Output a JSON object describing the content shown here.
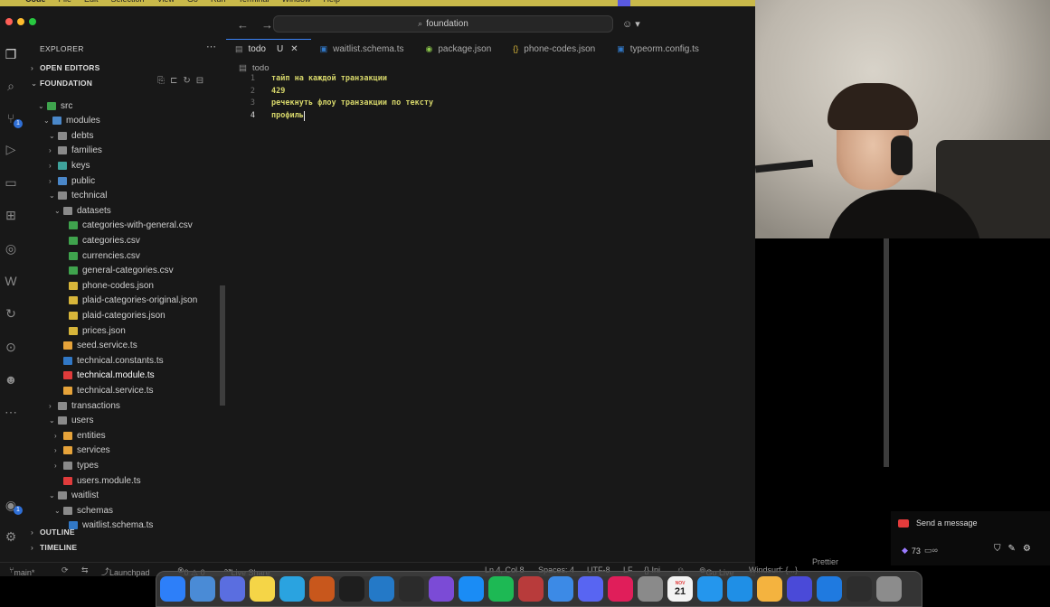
{
  "menubar": {
    "items": [
      "Code",
      "File",
      "Edit",
      "Selection",
      "View",
      "Go",
      "Run",
      "Terminal",
      "Window",
      "Help"
    ]
  },
  "titlebar": {
    "search_text": "foundation"
  },
  "sidebar": {
    "title": "EXPLORER",
    "sections": {
      "open_editors": "OPEN EDITORS",
      "foundation": "FOUNDATION",
      "outline": "OUTLINE",
      "timeline": "TIMELINE"
    },
    "tree": [
      {
        "label": "src",
        "kind": "folder-open",
        "color": "#3fa34d"
      },
      {
        "label": "modules",
        "kind": "folder-open",
        "color": "#4a87c9"
      },
      {
        "label": "debts",
        "kind": "folder-open",
        "color": "#8a8a8a"
      },
      {
        "label": "families",
        "kind": "folder",
        "color": "#8a8a8a"
      },
      {
        "label": "keys",
        "kind": "folder",
        "color": "#3fa39c"
      },
      {
        "label": "public",
        "kind": "folder",
        "color": "#4a87c9"
      },
      {
        "label": "technical",
        "kind": "folder-open",
        "color": "#8a8a8a"
      },
      {
        "label": "datasets",
        "kind": "folder-open",
        "color": "#8a8a8a"
      },
      {
        "label": "categories-with-general.csv",
        "kind": "csv",
        "color": "#3fa34d"
      },
      {
        "label": "categories.csv",
        "kind": "csv",
        "color": "#3fa34d"
      },
      {
        "label": "currencies.csv",
        "kind": "csv",
        "color": "#3fa34d"
      },
      {
        "label": "general-categories.csv",
        "kind": "csv",
        "color": "#3fa34d"
      },
      {
        "label": "phone-codes.json",
        "kind": "json",
        "color": "#d7b53a"
      },
      {
        "label": "plaid-categories-original.json",
        "kind": "json",
        "color": "#d7b53a"
      },
      {
        "label": "plaid-categories.json",
        "kind": "json",
        "color": "#d7b53a"
      },
      {
        "label": "prices.json",
        "kind": "json",
        "color": "#d7b53a"
      },
      {
        "label": "seed.service.ts",
        "kind": "ts-service",
        "color": "#e6a33a"
      },
      {
        "label": "technical.constants.ts",
        "kind": "ts",
        "color": "#3178c6"
      },
      {
        "label": "technical.module.ts",
        "kind": "ts-module",
        "color": "#e03b3b"
      },
      {
        "label": "technical.service.ts",
        "kind": "ts-service",
        "color": "#e6a33a"
      },
      {
        "label": "transactions",
        "kind": "folder",
        "color": "#8a8a8a"
      },
      {
        "label": "users",
        "kind": "folder-open",
        "color": "#8a8a8a"
      },
      {
        "label": "entities",
        "kind": "folder",
        "color": "#e6a33a"
      },
      {
        "label": "services",
        "kind": "folder",
        "color": "#e6a33a"
      },
      {
        "label": "types",
        "kind": "folder",
        "color": "#8a8a8a"
      },
      {
        "label": "users.module.ts",
        "kind": "ts-module",
        "color": "#e03b3b"
      },
      {
        "label": "waitlist",
        "kind": "folder-open",
        "color": "#8a8a8a"
      },
      {
        "label": "schemas",
        "kind": "folder-open",
        "color": "#8a8a8a"
      },
      {
        "label": "waitlist.schema.ts",
        "kind": "ts",
        "color": "#3178c6"
      }
    ]
  },
  "tabs": [
    {
      "label": "todo",
      "modified": "U",
      "icon": "file-icon"
    },
    {
      "label": "waitlist.schema.ts",
      "icon": "ts-icon"
    },
    {
      "label": "package.json",
      "icon": "npm-icon"
    },
    {
      "label": "phone-codes.json",
      "icon": "json-icon"
    },
    {
      "label": "typeorm.config.ts",
      "icon": "ts-icon"
    }
  ],
  "breadcrumb": "todo",
  "editor": {
    "lines": [
      {
        "n": "1",
        "text": "тайп на каждой транзакции"
      },
      {
        "n": "2",
        "text": "429"
      },
      {
        "n": "3",
        "text": "речекнуть флоу транзакции по тексту"
      },
      {
        "n": "4",
        "text": "профиль"
      }
    ]
  },
  "status": {
    "branch": "main*",
    "launchpad": "Launchpad",
    "problems": "0 ⚠ 0",
    "live_share": "Live Share",
    "position": "Ln 4, Col 8",
    "spaces": "Spaces: 4",
    "encoding": "UTF-8",
    "eol": "LF",
    "language": "{} Ini",
    "go_live": "Go Live",
    "windsurf": "Windsurf: {...}",
    "prettier": "Prettier"
  },
  "chat": {
    "send_message": "Send a message",
    "viewers": "73"
  },
  "dock_apps": [
    "finder",
    "xcode-tools",
    "arc",
    "notes",
    "telegram",
    "sublime",
    "cursor",
    "vscode",
    "terminal",
    "github-desktop",
    "app-store",
    "spotify",
    "bbedit",
    "nordvpn",
    "discord",
    "slack",
    "settings",
    "calendar",
    "docker",
    "safari",
    "tableplus",
    "ghost",
    "xcode",
    "obs",
    "trash"
  ],
  "calendar_day": "21",
  "calendar_month": "NOV",
  "colors": {
    "accent": "#3b82f6",
    "code": "#d6d66a",
    "editor_bg": "#181818"
  }
}
